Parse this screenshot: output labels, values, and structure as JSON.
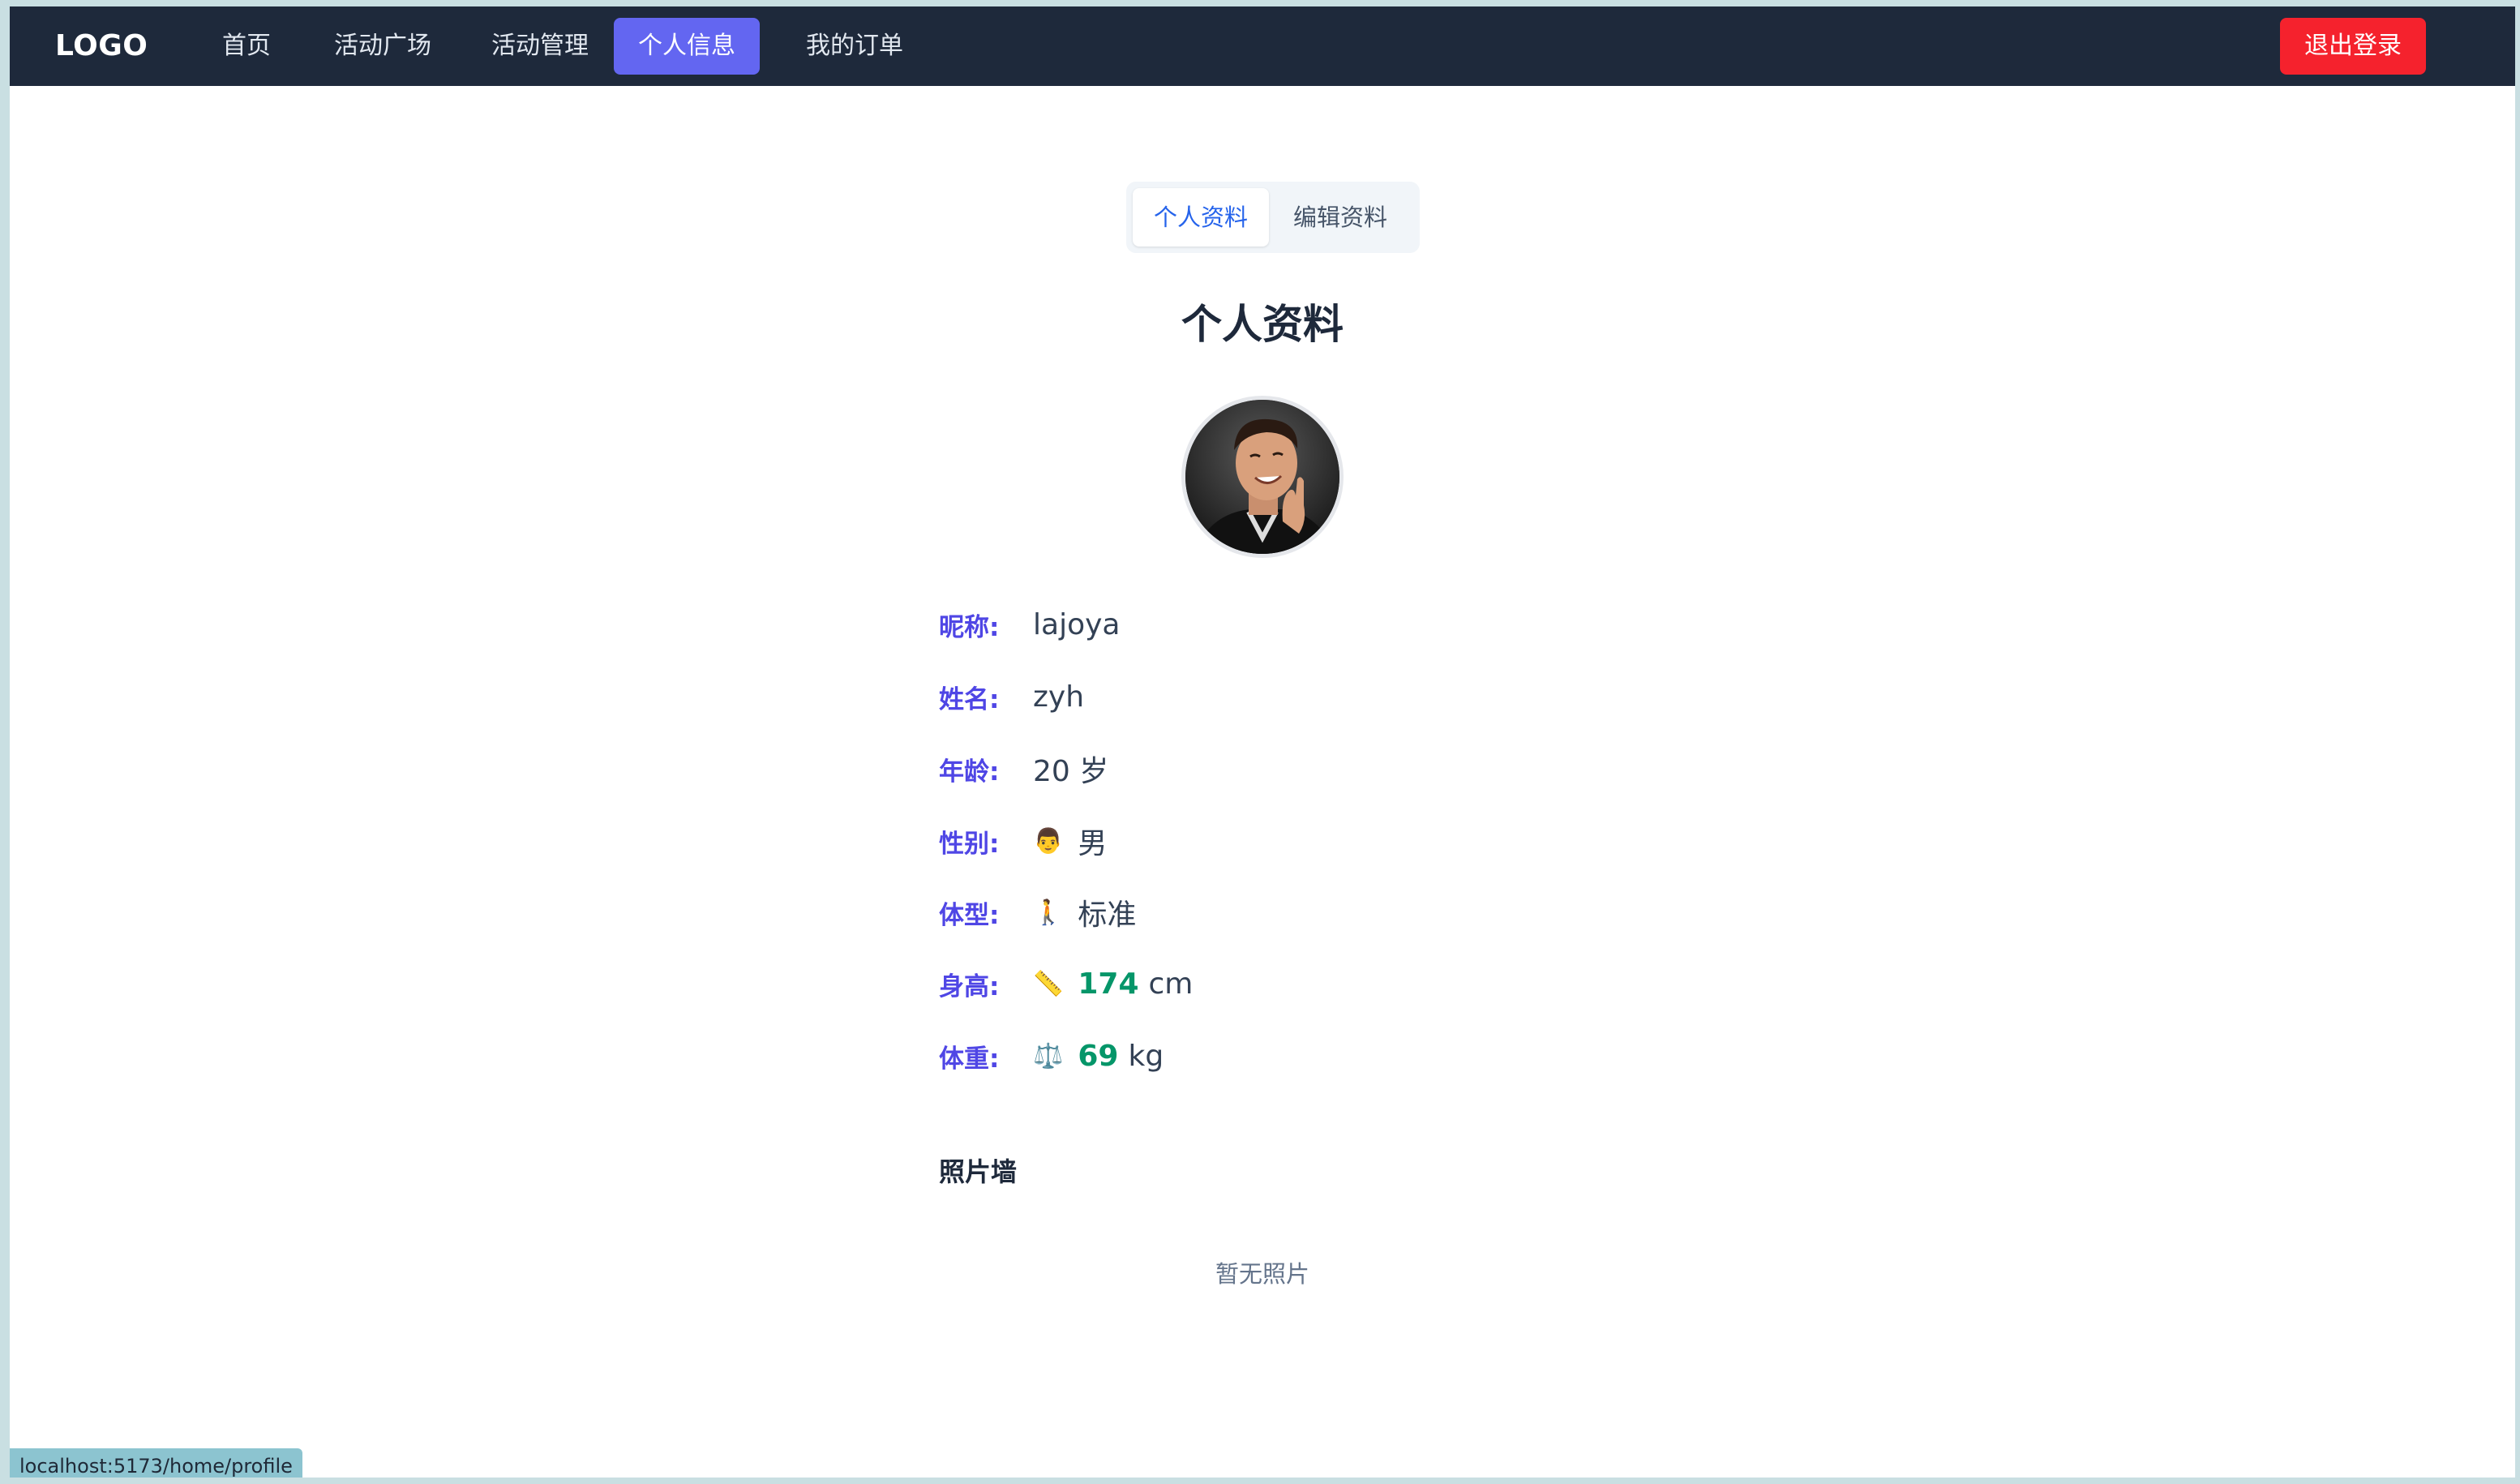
{
  "nav": {
    "logo": "LOGO",
    "items": [
      "首页",
      "活动广场",
      "活动管理",
      "个人信息",
      "我的订单"
    ],
    "logout": "退出登录"
  },
  "tabs": [
    "个人资料",
    "编辑资料"
  ],
  "title": "个人资料",
  "profile": {
    "nickname_label": "昵称:",
    "nickname": "lajoya",
    "name_label": "姓名:",
    "name": "zyh",
    "age_label": "年龄:",
    "age": "20 岁",
    "gender_label": "性别:",
    "gender_icon": "👨",
    "gender": "男",
    "body_label": "体型:",
    "body_icon": "🚶",
    "body": "标准",
    "height_label": "身高:",
    "height_icon": "📏",
    "height": "174",
    "height_unit": "cm",
    "weight_label": "体重:",
    "weight_icon": "⚖️",
    "weight": "69",
    "weight_unit": "kg"
  },
  "photo_wall": {
    "title": "照片墙",
    "empty": "暂无照片"
  },
  "status_url": "localhost:5173/home/profile",
  "colors": {
    "navbar_bg": "#1e293b",
    "active_nav": "#6366f1",
    "logout": "#f5222d",
    "label": "#4f46e5",
    "number": "#059669",
    "tab_active": "#2563eb"
  }
}
